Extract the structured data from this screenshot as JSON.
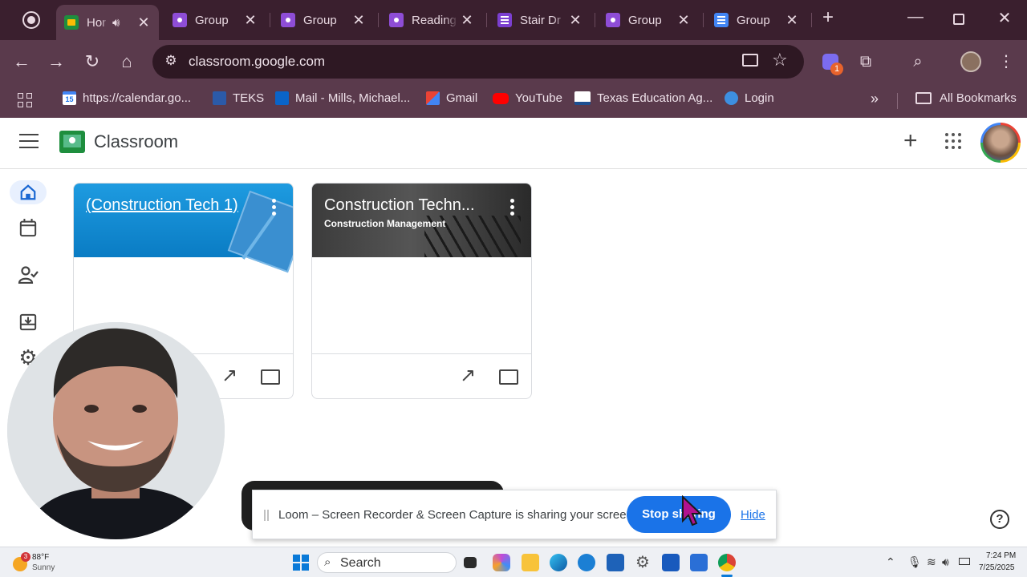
{
  "browser": {
    "tabs": [
      {
        "title": "Hor",
        "icon": "classroom-icon",
        "active": true,
        "audio": true
      },
      {
        "title": "Group",
        "icon": "group-icon"
      },
      {
        "title": "Group",
        "icon": "group-icon"
      },
      {
        "title": "Reading",
        "icon": "group-icon"
      },
      {
        "title": "Stair Dr",
        "icon": "forms-icon"
      },
      {
        "title": "Group",
        "icon": "group-icon"
      },
      {
        "title": "Group",
        "icon": "docs-icon"
      }
    ],
    "url": "classroom.google.com",
    "extension_badge": "1",
    "bookmarks": [
      {
        "label": "https://calendar.go...",
        "icon": "calendar-icon"
      },
      {
        "label": "TEKS",
        "icon": "teks-icon"
      },
      {
        "label": "Mail - Mills, Michael...",
        "icon": "outlook-icon"
      },
      {
        "label": "Gmail",
        "icon": "gmail-icon"
      },
      {
        "label": "YouTube",
        "icon": "youtube-icon"
      },
      {
        "label": "Texas Education Ag...",
        "icon": "tea-icon"
      },
      {
        "label": "Login",
        "icon": "login-icon"
      }
    ],
    "all_bookmarks_label": "All Bookmarks",
    "calendar_day": "15"
  },
  "classroom": {
    "brand": "Classroom",
    "cards": [
      {
        "title": "(Construction Tech 1)",
        "subtitle": ""
      },
      {
        "title": "Construction Techn...",
        "subtitle": "Construction Management"
      }
    ]
  },
  "share_bar": {
    "message": "Loom – Screen Recorder & Screen Capture is sharing your screen.",
    "stop_label": "Stop sharing",
    "hide_label": "Hide"
  },
  "taskbar": {
    "weather_temp": "88°F",
    "weather_cond": "Sunny",
    "weather_badge": "3",
    "search_label": "Search",
    "time": "7:24 PM",
    "date": "7/25/2025"
  },
  "colors": {
    "chrome_dark": "#3a1f2e",
    "chrome_mid": "#5a3a4c",
    "classroom_blue": "#1a73e8",
    "classroom_green": "#1e8e3e"
  }
}
